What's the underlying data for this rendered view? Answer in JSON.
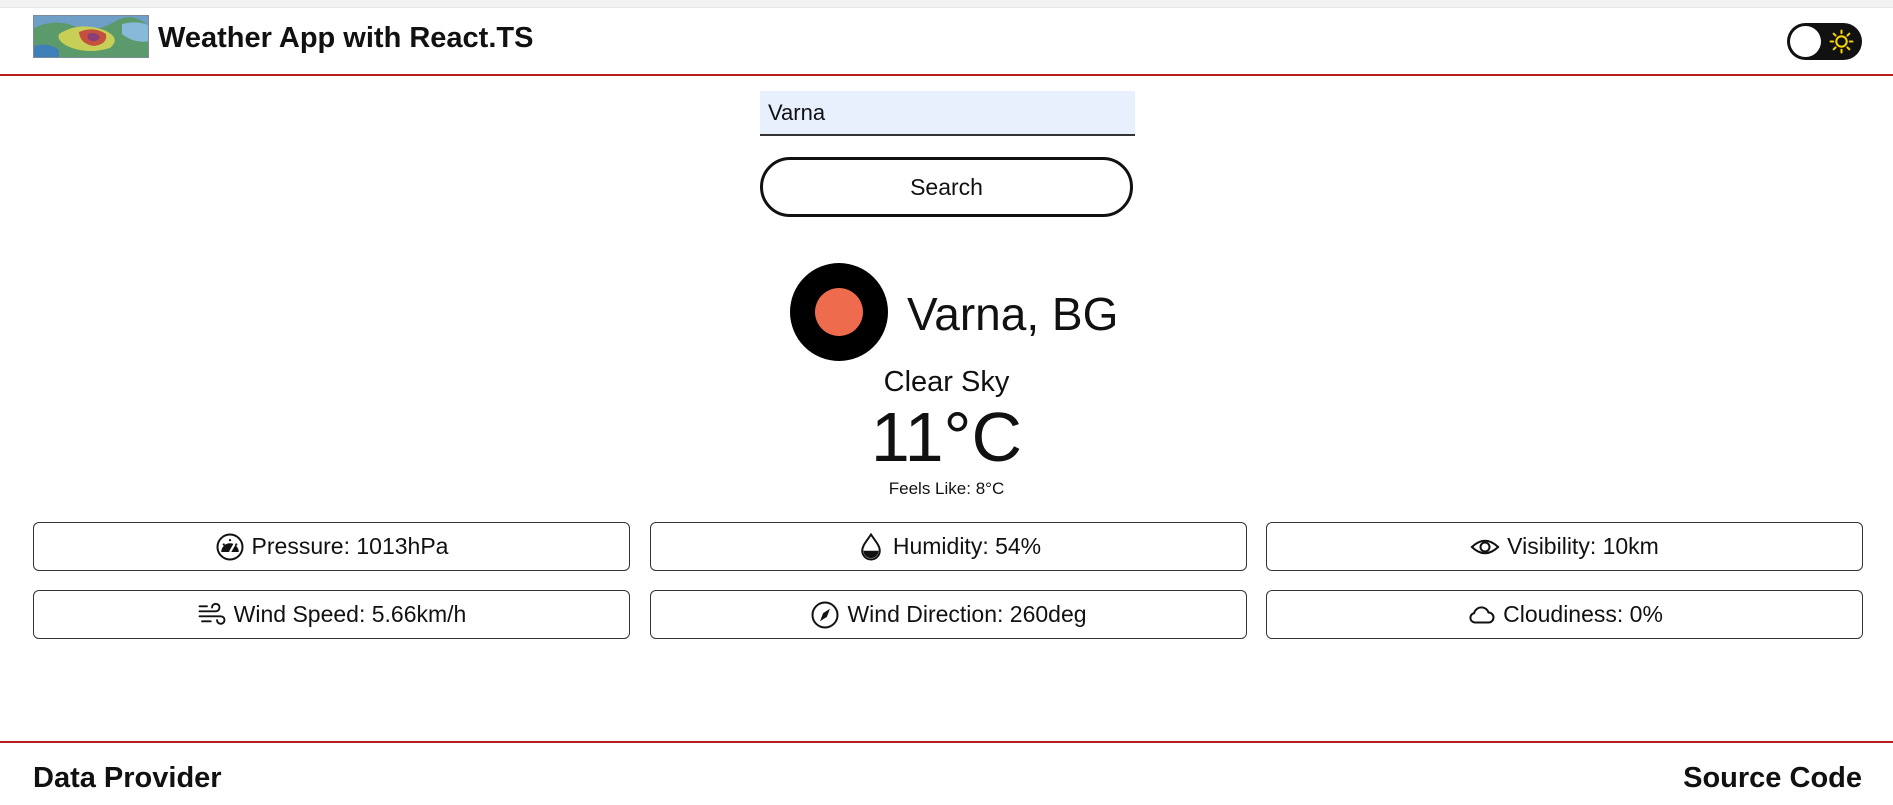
{
  "header": {
    "title": "Weather App with React.TS",
    "logo_icon": "weather-map-logo",
    "theme_toggle_icon": "sun-icon"
  },
  "search": {
    "value": "Varna",
    "button_label": "Search"
  },
  "weather": {
    "icon": "clear-sky-icon",
    "location": "Varna, BG",
    "description": "Clear Sky",
    "temperature": "11°C",
    "feels_like": "Feels Like: 8°C"
  },
  "details": {
    "pressure": "Pressure: 1013hPa",
    "humidity": "Humidity: 54%",
    "visibility": "Visibility: 10km",
    "wind_speed": "Wind Speed: 5.66km/h",
    "wind_direction": "Wind Direction: 260deg",
    "cloudiness": "Cloudiness: 0%"
  },
  "footer": {
    "data_provider": "Data Provider",
    "source_code": "Source Code"
  },
  "colors": {
    "accent_line": "#b71c1c",
    "sun": "#ee6b4d",
    "input_background": "#e8f0fe"
  }
}
